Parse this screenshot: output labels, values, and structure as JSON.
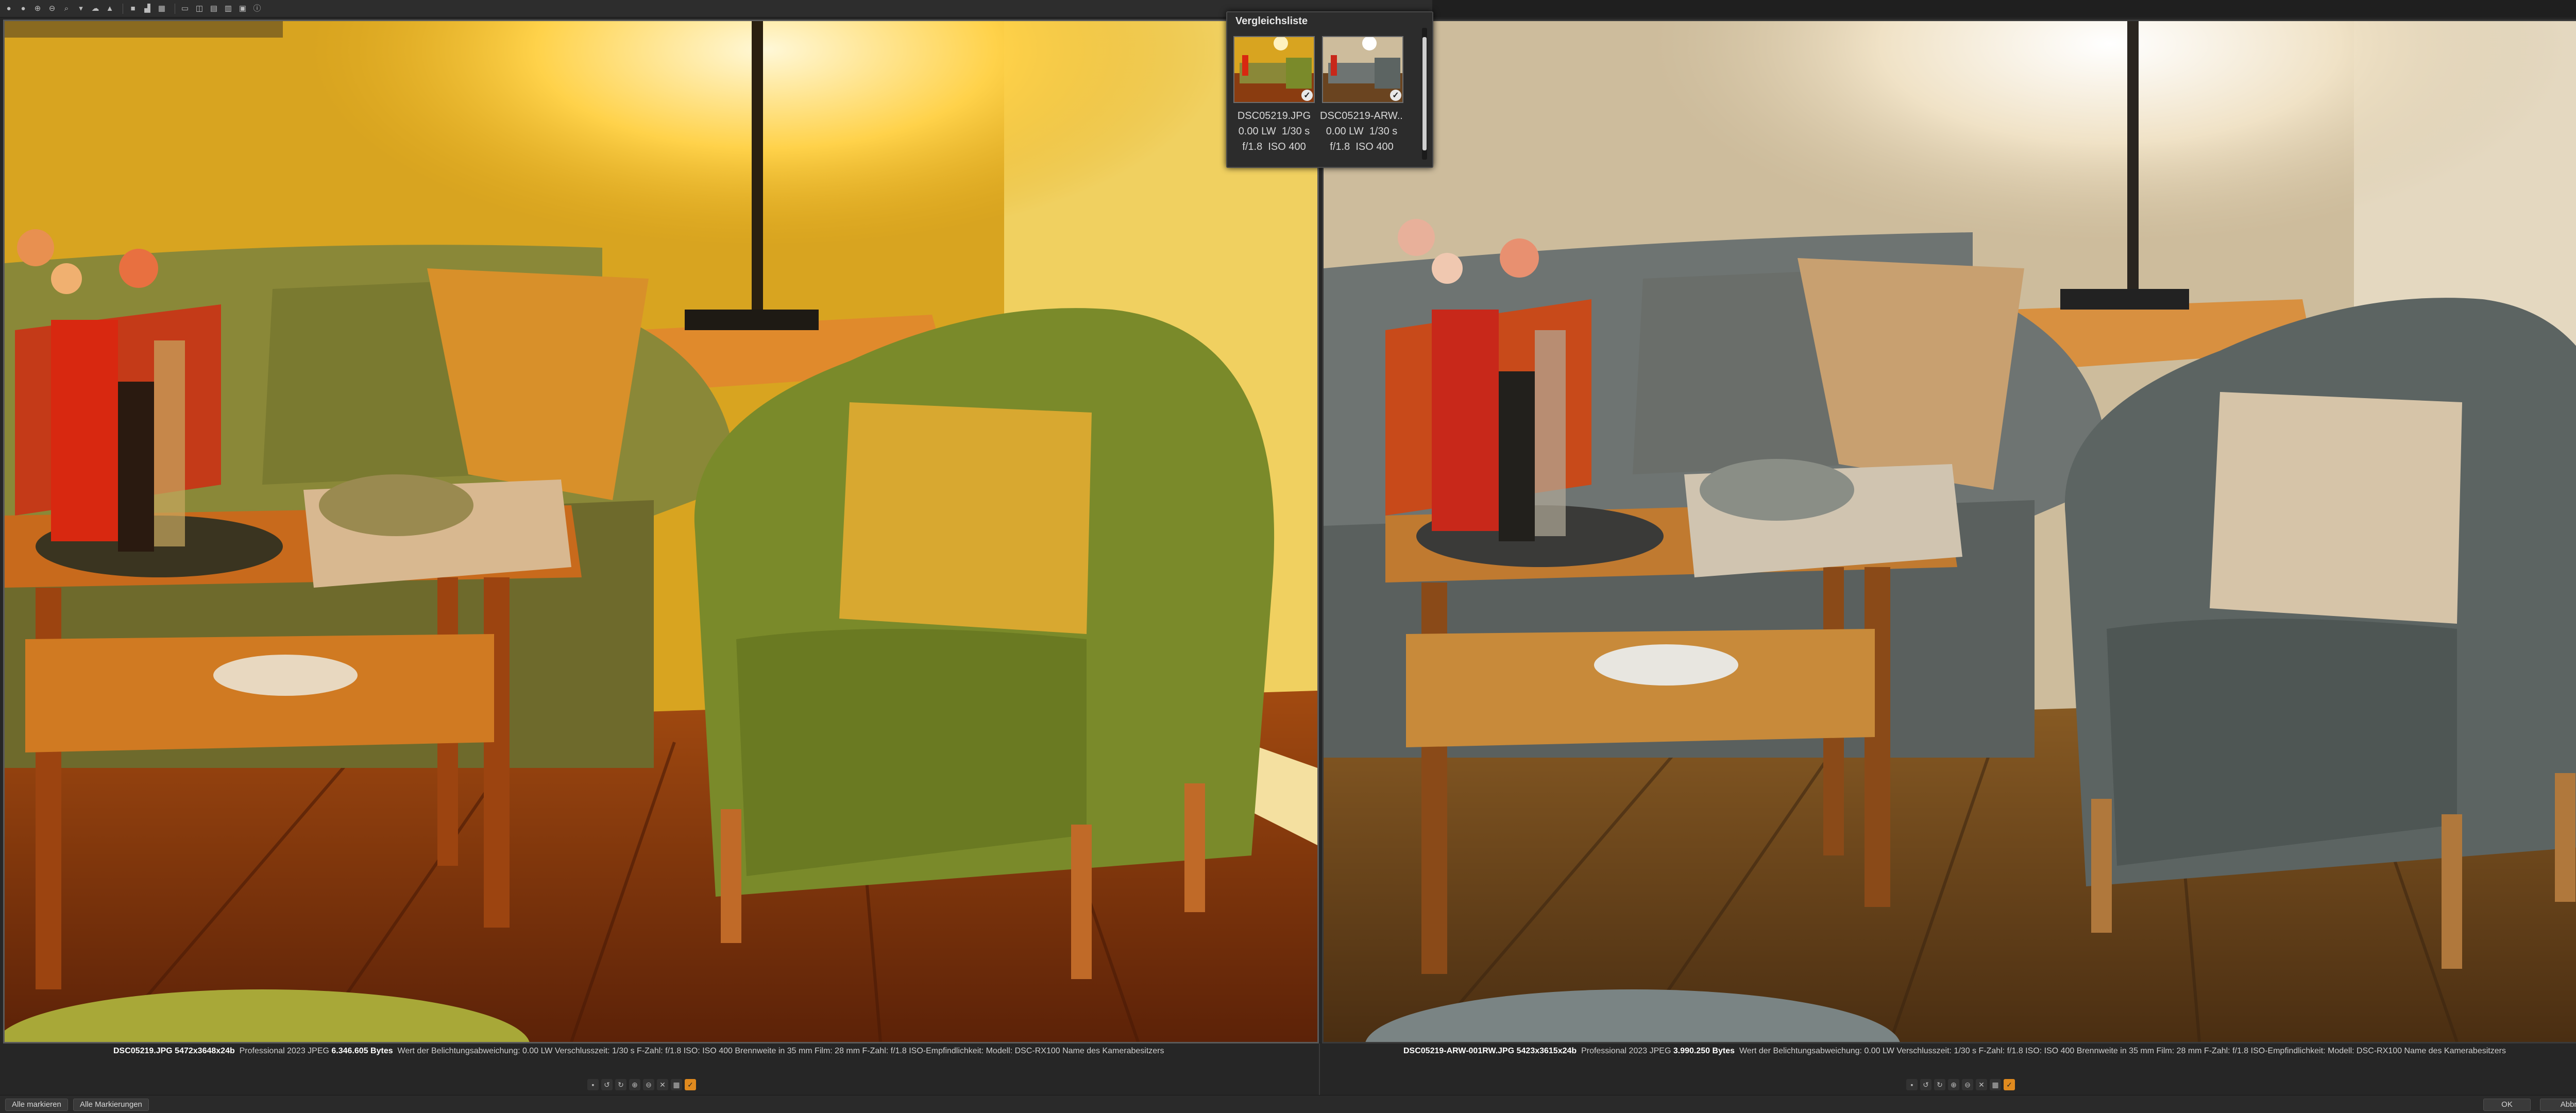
{
  "compare_list": {
    "title": "Vergleichsliste",
    "items": [
      {
        "name": "DSC05219.JPG",
        "exposure": "0.00 LW",
        "shutter": "1/30 s",
        "aperture": "f/1.8",
        "iso": "ISO 400",
        "checked": true
      },
      {
        "name": "DSC05219-ARW...",
        "exposure": "0.00 LW",
        "shutter": "1/30 s",
        "aperture": "f/1.8",
        "iso": "ISO 400",
        "checked": true
      }
    ]
  },
  "info_left": {
    "filename": "DSC05219.JPG 5472x3648x24b",
    "format": "Professional 2023 JPEG",
    "size": "6.346.605 Bytes",
    "rest": "Wert der Belichtungsabweichung: 0.00 LW  Verschlusszeit: 1/30 s  F-Zahl: f/1.8  ISO: ISO 400  Brennweite in 35 mm Film: 28 mm  F-Zahl: f/1.8  ISO-Empfindlichkeit: Modell: DSC-RX100  Name des Kamerabesitzers"
  },
  "info_right": {
    "filename": "DSC05219-ARW-001RW.JPG 5423x3615x24b",
    "format": "Professional 2023 JPEG",
    "size": "3.990.250 Bytes",
    "rest": "Wert der Belichtungsabweichung: 0.00 LW  Verschlusszeit: 1/30 s  F-Zahl: f/1.8  ISO: ISO 400  Brennweite in 35 mm Film: 28 mm  F-Zahl: f/1.8  ISO-Empfindlichkeit: Modell: DSC-RX100  Name des Kamerabesitzers"
  },
  "statusbar": {
    "mark_all": "Alle markieren",
    "unmark_all": "Alle Markierungen",
    "ok": "OK",
    "cancel": "Abbrechen"
  },
  "toolbar_icons": [
    "circle-icon",
    "circle-icon",
    "zoom-in-icon",
    "zoom-out-icon",
    "zoom-fit-icon",
    "dropdown-icon",
    "cloud-icon",
    "warning-icon",
    "square-icon",
    "histogram-icon",
    "grid-icon",
    "layout-icon",
    "layout-icon",
    "layout-icon",
    "layout-icon",
    "info-icon"
  ],
  "colors": {
    "accent": "#e08a1e",
    "background": "#262626"
  }
}
